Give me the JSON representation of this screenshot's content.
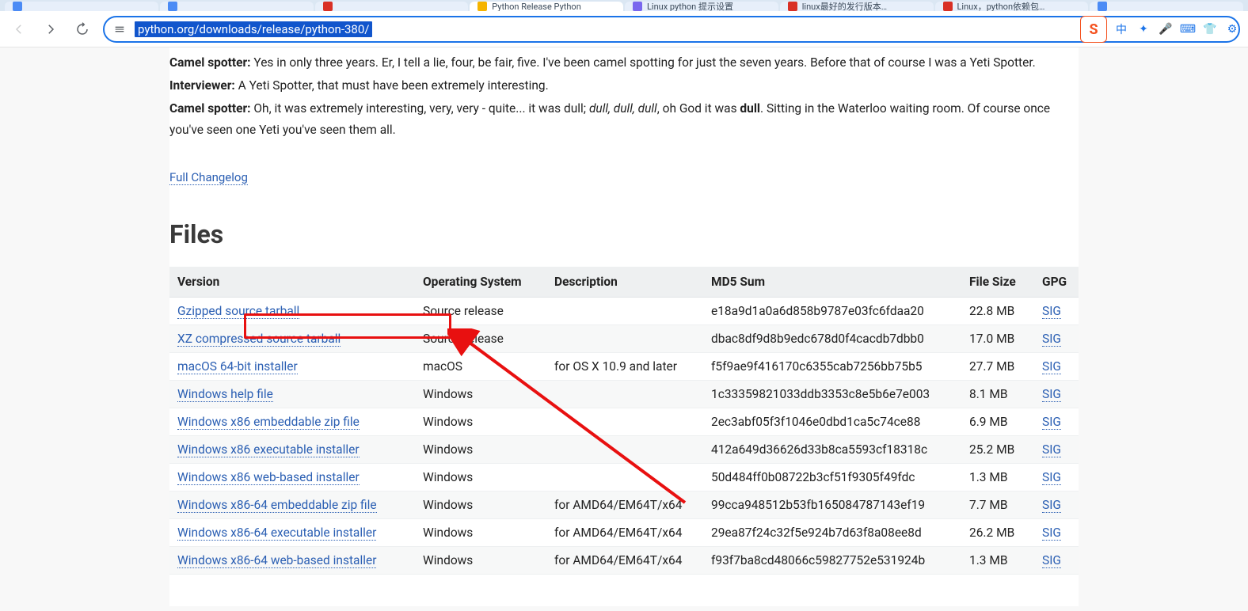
{
  "browser": {
    "url_selected": "python.org/downloads/release/python-380/",
    "tabs": [
      {
        "label": "",
        "kind": "blue"
      },
      {
        "label": "",
        "kind": "blue"
      },
      {
        "label": "",
        "kind": "red"
      },
      {
        "label": "Python Release Python",
        "kind": "orange",
        "active": true
      },
      {
        "label": "Linux python 提示设置",
        "kind": "purple"
      },
      {
        "label": "linux最好的发行版本…",
        "kind": "red"
      },
      {
        "label": "Linux，python依赖包…",
        "kind": "red"
      },
      {
        "label": "",
        "kind": "blue"
      }
    ],
    "ime_badge": "S",
    "ime_lang": "中"
  },
  "dialogue": {
    "line1_label": "Camel spotter:",
    "line1_text": " Yes in only three years. Er, I tell a lie, four, be fair, five. I've been camel spotting for just the seven years. Before that of course I was a Yeti Spotter.",
    "line2_label": "Interviewer:",
    "line2_text": " A Yeti Spotter, that must have been extremely interesting.",
    "line3_label": "Camel spotter:",
    "line3_text_a": " Oh, it was extremely interesting, very, very - quite... it was dull; ",
    "line3_em": "dull, dull, dull",
    "line3_text_b": ", oh God it was ",
    "line3_strong": "dull",
    "line3_text_c": ". Sitting in the Waterloo waiting room. Of course once you've seen one Yeti you've seen them all."
  },
  "changelog_link": "Full Changelog",
  "files_heading": "Files",
  "table": {
    "headers": {
      "version": "Version",
      "os": "Operating System",
      "desc": "Description",
      "md5": "MD5 Sum",
      "size": "File Size",
      "gpg": "GPG"
    },
    "sig_label": "SIG",
    "rows": [
      {
        "version": "Gzipped source tarball",
        "os": "Source release",
        "desc": "",
        "md5": "e18a9d1a0a6d858b9787e03fc6fdaa20",
        "size": "22.8 MB"
      },
      {
        "version": "XZ compressed source tarball",
        "os": "Source release",
        "desc": "",
        "md5": "dbac8df9d8b9edc678d0f4cacdb7dbb0",
        "size": "17.0 MB"
      },
      {
        "version": "macOS 64-bit installer",
        "os": "macOS",
        "desc": "for OS X 10.9 and later",
        "md5": "f5f9ae9f416170c6355cab7256bb75b5",
        "size": "27.7 MB"
      },
      {
        "version": "Windows help file",
        "os": "Windows",
        "desc": "",
        "md5": "1c33359821033ddb3353c8e5b6e7e003",
        "size": "8.1 MB"
      },
      {
        "version": "Windows x86 embeddable zip file",
        "os": "Windows",
        "desc": "",
        "md5": "2ec3abf05f3f1046e0dbd1ca5c74ce88",
        "size": "6.9 MB"
      },
      {
        "version": "Windows x86 executable installer",
        "os": "Windows",
        "desc": "",
        "md5": "412a649d36626d33b8ca5593cf18318c",
        "size": "25.2 MB"
      },
      {
        "version": "Windows x86 web-based installer",
        "os": "Windows",
        "desc": "",
        "md5": "50d484ff0b08722b3cf51f9305f49fdc",
        "size": "1.3 MB"
      },
      {
        "version": "Windows x86-64 embeddable zip file",
        "os": "Windows",
        "desc": "for AMD64/EM64T/x64",
        "md5": "99cca948512b53fb165084787143ef19",
        "size": "7.7 MB"
      },
      {
        "version": "Windows x86-64 executable installer",
        "os": "Windows",
        "desc": "for AMD64/EM64T/x64",
        "md5": "29ea87f24c32f5e924b7d63f8a08ee8d",
        "size": "26.2 MB"
      },
      {
        "version": "Windows x86-64 web-based installer",
        "os": "Windows",
        "desc": "for AMD64/EM64T/x64",
        "md5": "f93f7ba8cd48066c59827752e531924b",
        "size": "1.3 MB"
      }
    ]
  }
}
